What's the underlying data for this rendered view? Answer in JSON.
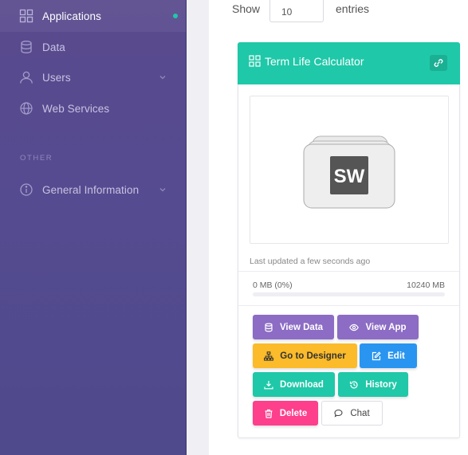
{
  "sidebar": {
    "items": [
      {
        "label": "Applications",
        "icon": "grid-icon"
      },
      {
        "label": "Data",
        "icon": "database-icon"
      },
      {
        "label": "Users",
        "icon": "user-icon"
      },
      {
        "label": "Web Services",
        "icon": "globe-icon"
      },
      {
        "label": "General Information",
        "icon": "info-icon"
      }
    ],
    "section_other": "OTHER"
  },
  "table_controls": {
    "show_label": "Show",
    "entries_value": "10",
    "entries_label": "entries"
  },
  "card": {
    "title": "Term Life Calculator",
    "logo_text": "SW",
    "last_updated": "Last updated a few seconds ago",
    "storage_used": "0 MB  (0%)",
    "storage_max": "10240 MB",
    "storage_fraction": 0,
    "buttons": {
      "view_data": "View Data",
      "view_app": "View App",
      "go_to_designer": "Go to Designer",
      "edit": "Edit",
      "download": "Download",
      "history": "History",
      "delete": "Delete",
      "chat": "Chat"
    }
  },
  "colors": {
    "accent": "#1fc8a8",
    "purple": "#8c6cc4",
    "yellow": "#fbbb2a",
    "blue": "#2a95f0",
    "pink": "#fd3f8c"
  }
}
